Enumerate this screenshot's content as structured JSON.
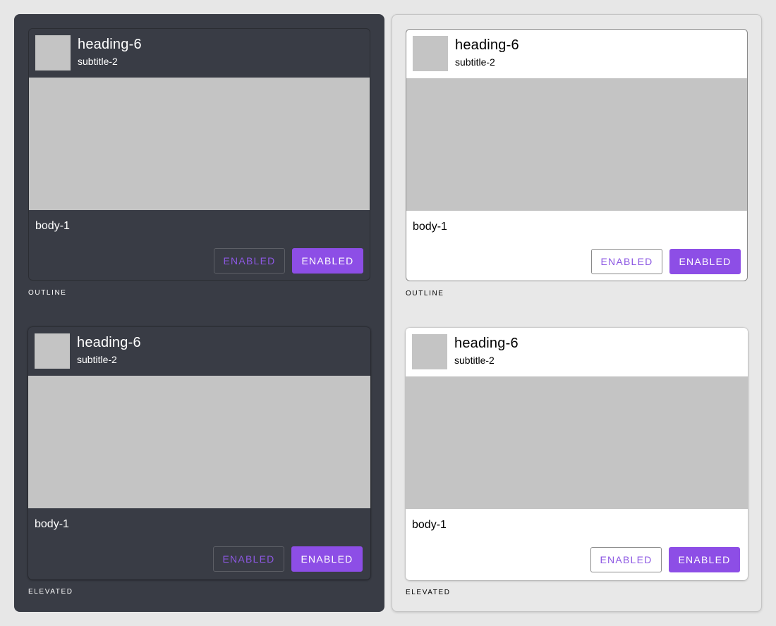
{
  "panels": {
    "dark": {
      "outline_card": {
        "heading": "heading-6",
        "subtitle": "subtitle-2",
        "body": "body-1",
        "outlined_button": "ENABLED",
        "contained_button": "ENABLED"
      },
      "outline_caption": "OUTLINE",
      "elevated_card": {
        "heading": "heading-6",
        "subtitle": "subtitle-2",
        "body": "body-1",
        "outlined_button": "ENABLED",
        "contained_button": "ENABLED"
      },
      "elevated_caption": "ELEVATED"
    },
    "light": {
      "outline_card": {
        "heading": "heading-6",
        "subtitle": "subtitle-2",
        "body": "body-1",
        "outlined_button": "ENABLED",
        "contained_button": "ENABLED"
      },
      "outline_caption": "OUTLINE",
      "elevated_card": {
        "heading": "heading-6",
        "subtitle": "subtitle-2",
        "body": "body-1",
        "outlined_button": "ENABLED",
        "contained_button": "ENABLED"
      },
      "elevated_caption": "ELEVATED"
    }
  },
  "colors": {
    "dark_surface": "#393c45",
    "light_surface": "#ffffff",
    "page_background": "#e7e7e7",
    "placeholder": "#c4c4c4",
    "accent": "#8d4ee6"
  }
}
